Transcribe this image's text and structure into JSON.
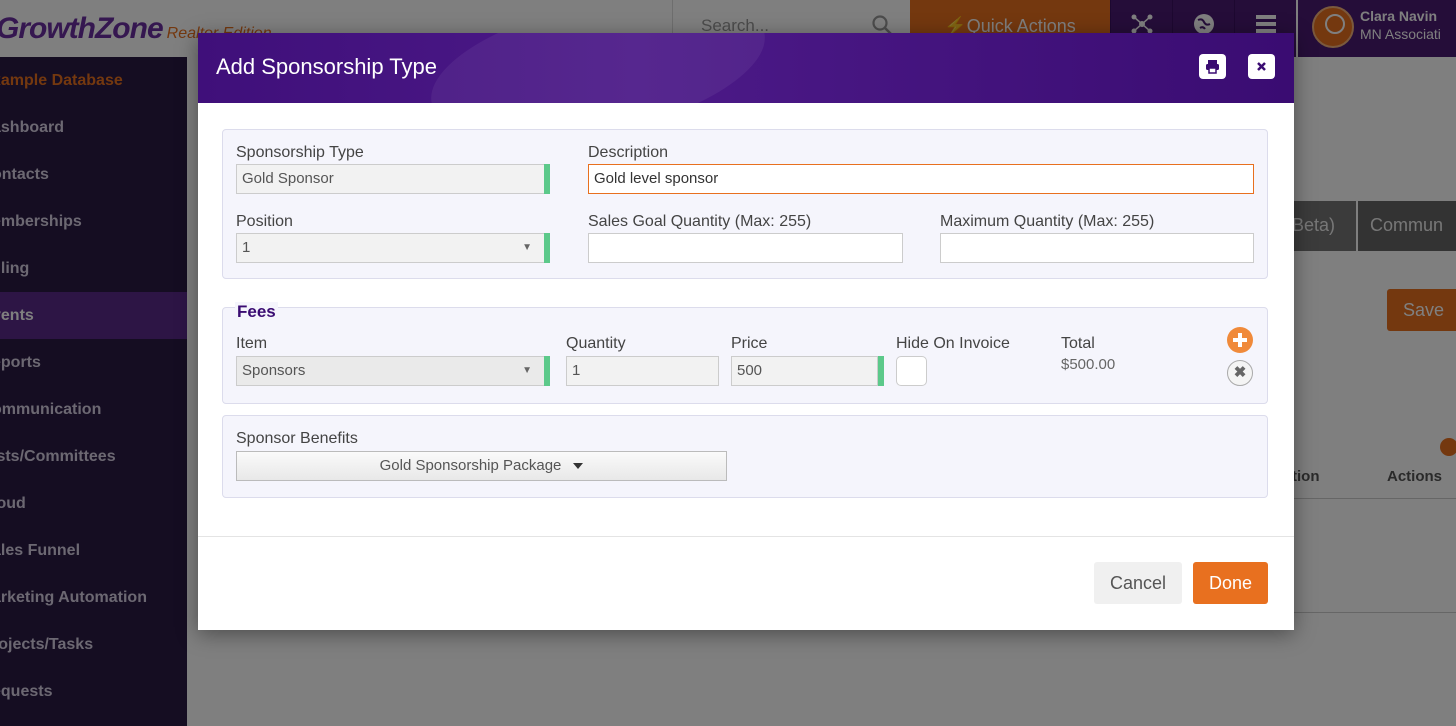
{
  "app": {
    "logo_brand": "GrowthZone",
    "logo_edition": "Realtor Edition",
    "search_placeholder": "Search...",
    "quick_actions_label": "Quick Actions",
    "user_name": "Clara Navin",
    "user_org": "MN Associati"
  },
  "sidebar": {
    "items": [
      {
        "label": "xample Database"
      },
      {
        "label": "ashboard"
      },
      {
        "label": "ontacts"
      },
      {
        "label": "emberships"
      },
      {
        "label": "illing"
      },
      {
        "label": "vents"
      },
      {
        "label": "eports"
      },
      {
        "label": "ommunication"
      },
      {
        "label": "ists/Committees"
      },
      {
        "label": "loud"
      },
      {
        "label": "ales Funnel"
      },
      {
        "label": "arketing Automation"
      },
      {
        "label": "rojects/Tasks"
      },
      {
        "label": "equests"
      }
    ]
  },
  "background": {
    "tab_beta": "Beta)",
    "tab_commun": "Commun",
    "save_label": "Save",
    "col_tion": "tion",
    "col_actions": "Actions"
  },
  "modal": {
    "title": "Add Sponsorship Type",
    "sponsorship_type_label": "Sponsorship Type",
    "sponsorship_type_value": "Gold Sponsor",
    "description_label": "Description",
    "description_value": "Gold level sponsor",
    "position_label": "Position",
    "position_value": "1",
    "sales_goal_label": "Sales Goal Quantity (Max: 255)",
    "sales_goal_value": "",
    "max_quantity_label": "Maximum Quantity (Max: 255)",
    "max_quantity_value": "",
    "fees": {
      "title": "Fees",
      "item_label": "Item",
      "item_value": "Sponsors",
      "quantity_label": "Quantity",
      "quantity_value": "1",
      "price_label": "Price",
      "price_value": "500",
      "hide_on_invoice_label": "Hide On Invoice",
      "total_label": "Total",
      "total_value": "$500.00"
    },
    "sponsor_benefits_label": "Sponsor Benefits",
    "sponsor_benefits_value": "Gold Sponsorship Package",
    "cancel_label": "Cancel",
    "done_label": "Done"
  },
  "colors": {
    "accent": "#e8701f",
    "brand_purple": "#4a1b73",
    "required_marker": "#5cc98a"
  }
}
